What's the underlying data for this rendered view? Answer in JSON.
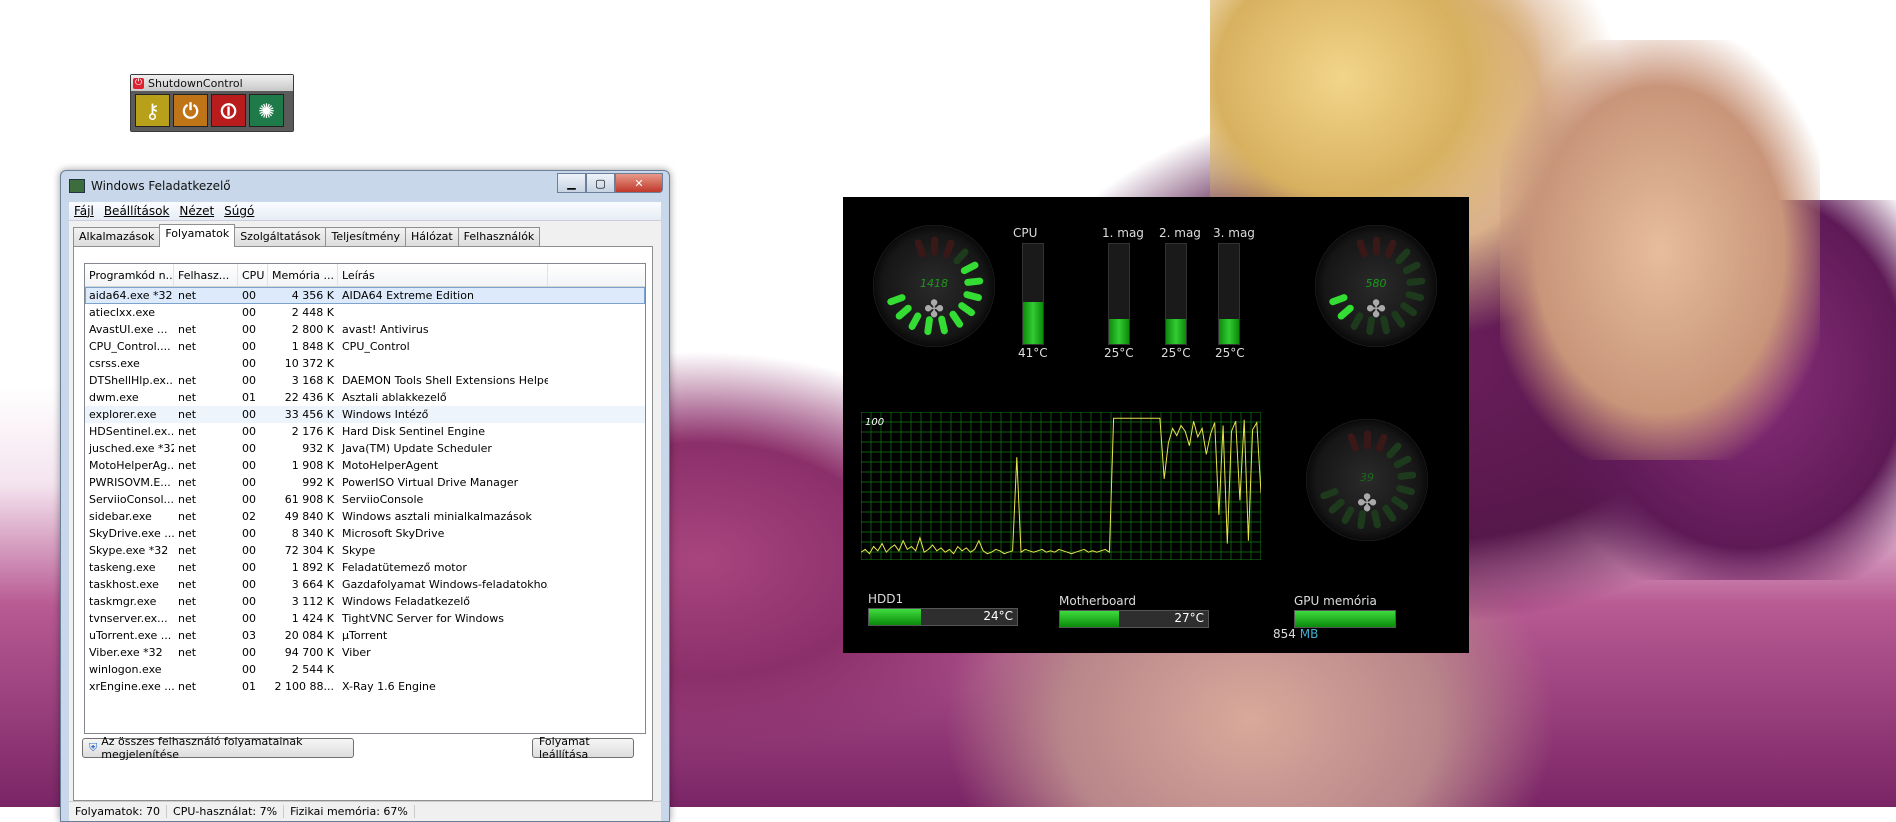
{
  "shutdown": {
    "title": "ShutdownControl",
    "buttons": [
      {
        "icon": "key-icon",
        "color": "#b8a01a"
      },
      {
        "icon": "power-icon",
        "color": "#c07418"
      },
      {
        "icon": "shutdown-icon",
        "color": "#b81c1c"
      },
      {
        "icon": "restart-icon",
        "color": "#1f7a4a"
      }
    ]
  },
  "taskmanager": {
    "title": "Windows Feladatkezelő",
    "menu": [
      "Fájl",
      "Beállítások",
      "Nézet",
      "Súgó"
    ],
    "tabs": [
      "Alkalmazások",
      "Folyamatok",
      "Szolgáltatások",
      "Teljesítmény",
      "Hálózat",
      "Felhasználók"
    ],
    "active_tab": "Folyamatok",
    "columns": [
      "Programkód n...",
      "Felhasz...",
      "CPU",
      "Memória ...",
      "Leírás"
    ],
    "rows": [
      [
        "aida64.exe *32",
        "net",
        "00",
        "4 356 K",
        "AIDA64 Extreme Edition"
      ],
      [
        "atieclxx.exe",
        "",
        "00",
        "2 448 K",
        ""
      ],
      [
        "AvastUI.exe ...",
        "net",
        "00",
        "2 800 K",
        "avast! Antivirus"
      ],
      [
        "CPU_Control....",
        "net",
        "00",
        "1 848 K",
        "CPU_Control"
      ],
      [
        "csrss.exe",
        "",
        "00",
        "10 372 K",
        ""
      ],
      [
        "DTShellHlp.ex...",
        "net",
        "00",
        "3 168 K",
        "DAEMON Tools Shell Extensions Helper"
      ],
      [
        "dwm.exe",
        "net",
        "01",
        "22 436 K",
        "Asztali ablakkezelő"
      ],
      [
        "explorer.exe",
        "net",
        "00",
        "33 456 K",
        "Windows Intéző"
      ],
      [
        "HDSentinel.ex...",
        "net",
        "00",
        "2 176 K",
        "Hard Disk Sentinel Engine"
      ],
      [
        "jusched.exe *32",
        "net",
        "00",
        "932 K",
        "Java(TM) Update Scheduler"
      ],
      [
        "MotoHelperAg...",
        "net",
        "00",
        "1 908 K",
        "MotoHelperAgent"
      ],
      [
        "PWRISOVM.E...",
        "net",
        "00",
        "992 K",
        "PowerISO Virtual Drive Manager"
      ],
      [
        "ServiioConsol...",
        "net",
        "00",
        "61 908 K",
        "ServiioConsole"
      ],
      [
        "sidebar.exe",
        "net",
        "02",
        "49 840 K",
        "Windows asztali minialkalmazások"
      ],
      [
        "SkyDrive.exe ...",
        "net",
        "00",
        "8 340 K",
        "Microsoft SkyDrive"
      ],
      [
        "Skype.exe *32",
        "net",
        "00",
        "72 304 K",
        "Skype"
      ],
      [
        "taskeng.exe",
        "net",
        "00",
        "1 892 K",
        "Feladatütemező motor"
      ],
      [
        "taskhost.exe",
        "net",
        "00",
        "3 664 K",
        "Gazdafolyamat Windows-feladatokhoz"
      ],
      [
        "taskmgr.exe",
        "net",
        "00",
        "3 112 K",
        "Windows Feladatkezelő"
      ],
      [
        "tvnserver.ex...",
        "net",
        "00",
        "1 424 K",
        "TightVNC Server for Windows"
      ],
      [
        "uTorrent.exe ...",
        "net",
        "03",
        "20 084 K",
        "µTorrent"
      ],
      [
        "Viber.exe *32",
        "net",
        "00",
        "94 700 K",
        "Viber"
      ],
      [
        "winlogon.exe",
        "",
        "00",
        "2 544 K",
        ""
      ],
      [
        "xrEngine.exe ...",
        "net",
        "01",
        "2 100 88...",
        "X-Ray 1.6 Engine"
      ]
    ],
    "selected_row": 0,
    "highlighted_row": 7,
    "show_all_button": "Az összes felhasználó folyamatainak megjelenítése",
    "end_process_button": "Folyamat leállítása",
    "status": {
      "processes": "Folyamatok: 70",
      "cpu": "CPU-használat: 7%",
      "memory": "Fizikai memória: 67%"
    }
  },
  "gadget": {
    "fan_gauges": [
      {
        "value": "1418",
        "level": 0.75
      },
      {
        "value": "580",
        "level": 0.15
      },
      {
        "value": "39",
        "level": 0.0
      }
    ],
    "temp_bars": [
      {
        "label": "CPU",
        "temp": "41°C",
        "level": 0.42
      },
      {
        "label": "1. mag",
        "temp": "25°C",
        "level": 0.25
      },
      {
        "label": "2. mag",
        "temp": "25°C",
        "level": 0.25
      },
      {
        "label": "3. mag",
        "temp": "25°C",
        "level": 0.25
      }
    ],
    "graph_max": "100",
    "graph_values": [
      4,
      6,
      3,
      8,
      5,
      10,
      4,
      7,
      9,
      5,
      12,
      6,
      8,
      5,
      14,
      4,
      6,
      9,
      5,
      7,
      4,
      6,
      3,
      8,
      5,
      7,
      4,
      6,
      12,
      5,
      3,
      4,
      6,
      5,
      3,
      4,
      5,
      70,
      4,
      6,
      5,
      4,
      5,
      6,
      4,
      5,
      4,
      6,
      5,
      4,
      3,
      4,
      5,
      6,
      4,
      5,
      4,
      5,
      6,
      4,
      97,
      97,
      97,
      97,
      97,
      97,
      97,
      97,
      97,
      97,
      97,
      97,
      55,
      80,
      90,
      85,
      92,
      88,
      78,
      95,
      84,
      90,
      72,
      86,
      94,
      30,
      92,
      10,
      88,
      95,
      40,
      96,
      12,
      89,
      94,
      45
    ],
    "hdd": {
      "label": "HDD1",
      "temp": "24°C",
      "level": 0.35
    },
    "motherboard": {
      "label": "Motherboard",
      "temp": "27°C",
      "level": 0.4
    },
    "gpu": {
      "label": "GPU memória",
      "value": "854",
      "unit": "MB",
      "level": 1.0
    },
    "colors": {
      "accent": "#33cc33",
      "unit": "#3fb0d0"
    }
  }
}
